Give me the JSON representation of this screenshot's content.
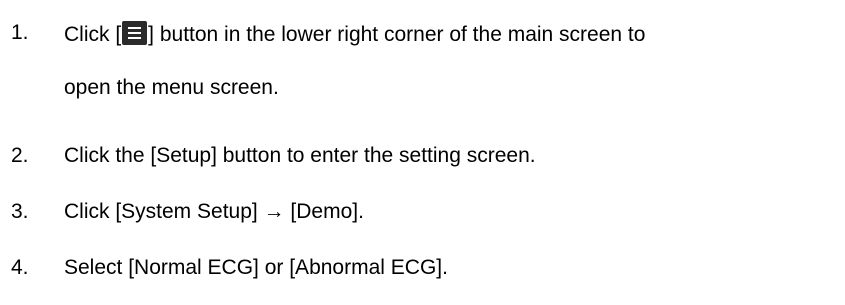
{
  "steps": [
    {
      "number": "1.",
      "text_before_icon": "Click [",
      "icon": "menu-icon",
      "text_after_icon": "] button in the lower right corner of the main screen to",
      "text_line2": "open the menu screen."
    },
    {
      "number": "2.",
      "text": "Click the [Setup] button to enter the setting screen."
    },
    {
      "number": "3.",
      "text": "Click [System Setup] → [Demo]."
    },
    {
      "number": "4.",
      "text": "Select [Normal ECG] or [Abnormal ECG]."
    }
  ]
}
